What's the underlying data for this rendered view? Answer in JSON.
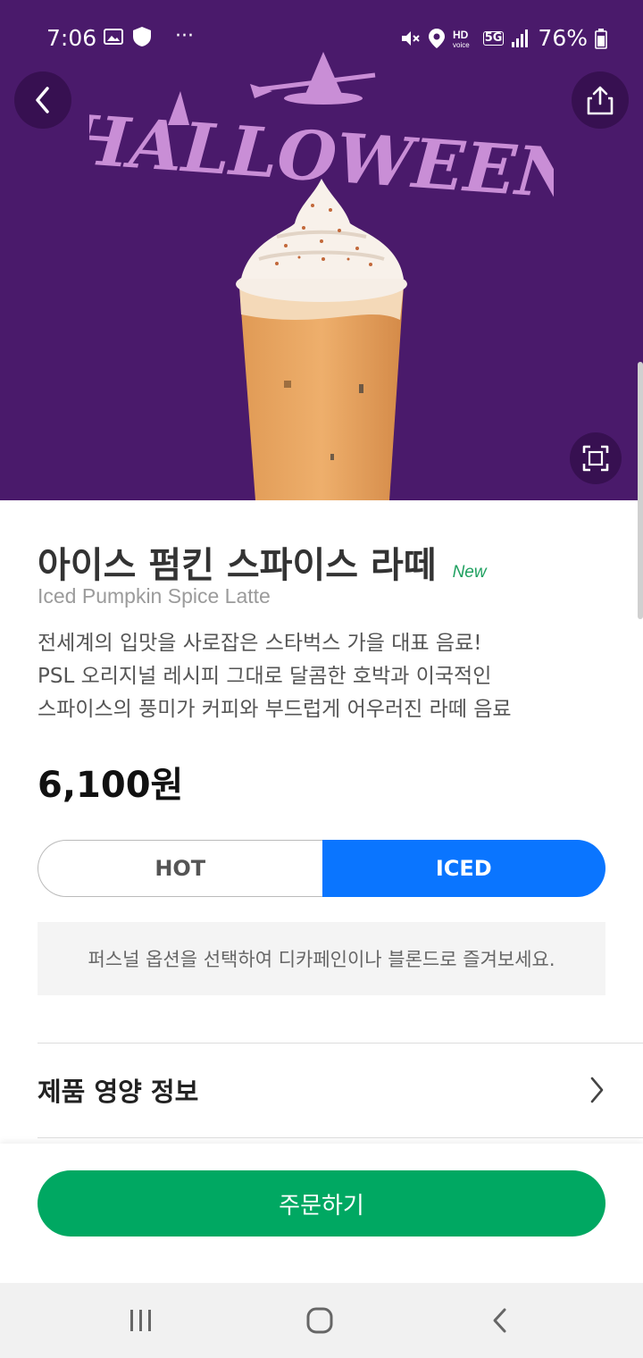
{
  "status_bar": {
    "time": "7:06",
    "battery": "76%",
    "network": "5G",
    "icons": [
      "image-icon",
      "shield-icon",
      "more-icon",
      "mute-icon",
      "location-icon",
      "hd-voice-icon",
      "5g-icon",
      "signal-icon",
      "battery-icon"
    ]
  },
  "hero": {
    "banner_text": "HALLOWEEN",
    "background_color": "#4a1a6b",
    "buttons": [
      "back-icon",
      "share-icon",
      "expand-icon"
    ]
  },
  "product": {
    "name": "아이스 펌킨 스파이스 라떼",
    "badge": "New",
    "english_name": "Iced Pumpkin Spice Latte",
    "description_lines": [
      "전세계의 입맛을 사로잡은 스타벅스 가을 대표 음료!",
      "PSL 오리지널 레시피 그대로 달콤한 호박과 이국적인",
      "스파이스의 풍미가 커피와 부드럽게 어우러진 라떼 음료"
    ],
    "price": "6,100원"
  },
  "temperature": {
    "options": [
      "HOT",
      "ICED"
    ],
    "selected": "ICED",
    "selected_color": "#0a75ff"
  },
  "note": "퍼스널 옵션을 선택하여 디카페인이나 블론드로 즐겨보세요.",
  "nutrition": {
    "label": "제품 영양 정보"
  },
  "order": {
    "label": "주문하기",
    "color": "#00a862"
  },
  "nav_bar": {
    "items": [
      "recent-apps-icon",
      "home-icon",
      "back-icon"
    ]
  }
}
